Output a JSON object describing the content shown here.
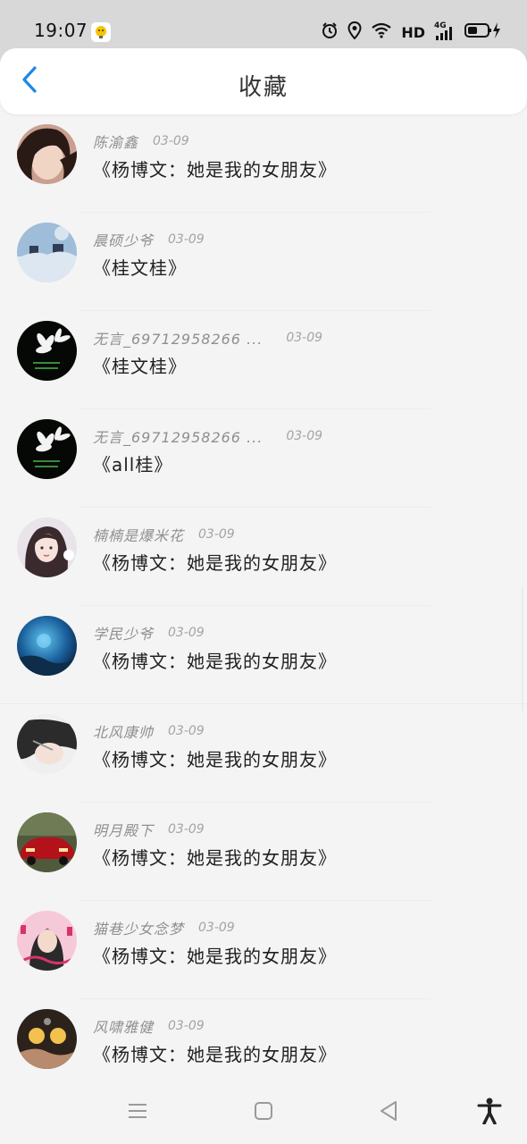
{
  "status_bar": {
    "time": "19:07",
    "network": "HD",
    "cell": "4G"
  },
  "header": {
    "title": "收藏",
    "back_icon": "chevron-left-icon"
  },
  "items": [
    {
      "name": "陈渝鑫",
      "date": "03-09",
      "content": "《杨博文：她是我的女朋友》"
    },
    {
      "name": "晨硕少爷",
      "date": "03-09",
      "content": "《桂文桂》"
    },
    {
      "name": "无言_69712958266 ...",
      "date": "03-09",
      "content": "《桂文桂》"
    },
    {
      "name": "无言_69712958266 ...",
      "date": "03-09",
      "content": "《all桂》"
    },
    {
      "name": "楠楠是爆米花",
      "date": "03-09",
      "content": "《杨博文：她是我的女朋友》"
    },
    {
      "name": "学民少爷",
      "date": "03-09",
      "content": "《杨博文：她是我的女朋友》"
    },
    {
      "name": "北风康帅",
      "date": "03-09",
      "content": "《杨博文：她是我的女朋友》"
    },
    {
      "name": "明月殿下",
      "date": "03-09",
      "content": "《杨博文：她是我的女朋友》"
    },
    {
      "name": "猫巷少女念梦",
      "date": "03-09",
      "content": "《杨博文：她是我的女朋友》"
    },
    {
      "name": "风啸雅健",
      "date": "03-09",
      "content": "《杨博文：她是我的女朋友》"
    }
  ],
  "nav_bar": {
    "menu_icon": "menu-icon",
    "home_icon": "home-square-icon",
    "back_icon": "back-triangle-icon",
    "accessibility_icon": "accessibility-icon"
  },
  "colors": {
    "accent": "#1e88e5",
    "meta_text": "#8f8f8f",
    "content_text": "#1f1f1f"
  }
}
